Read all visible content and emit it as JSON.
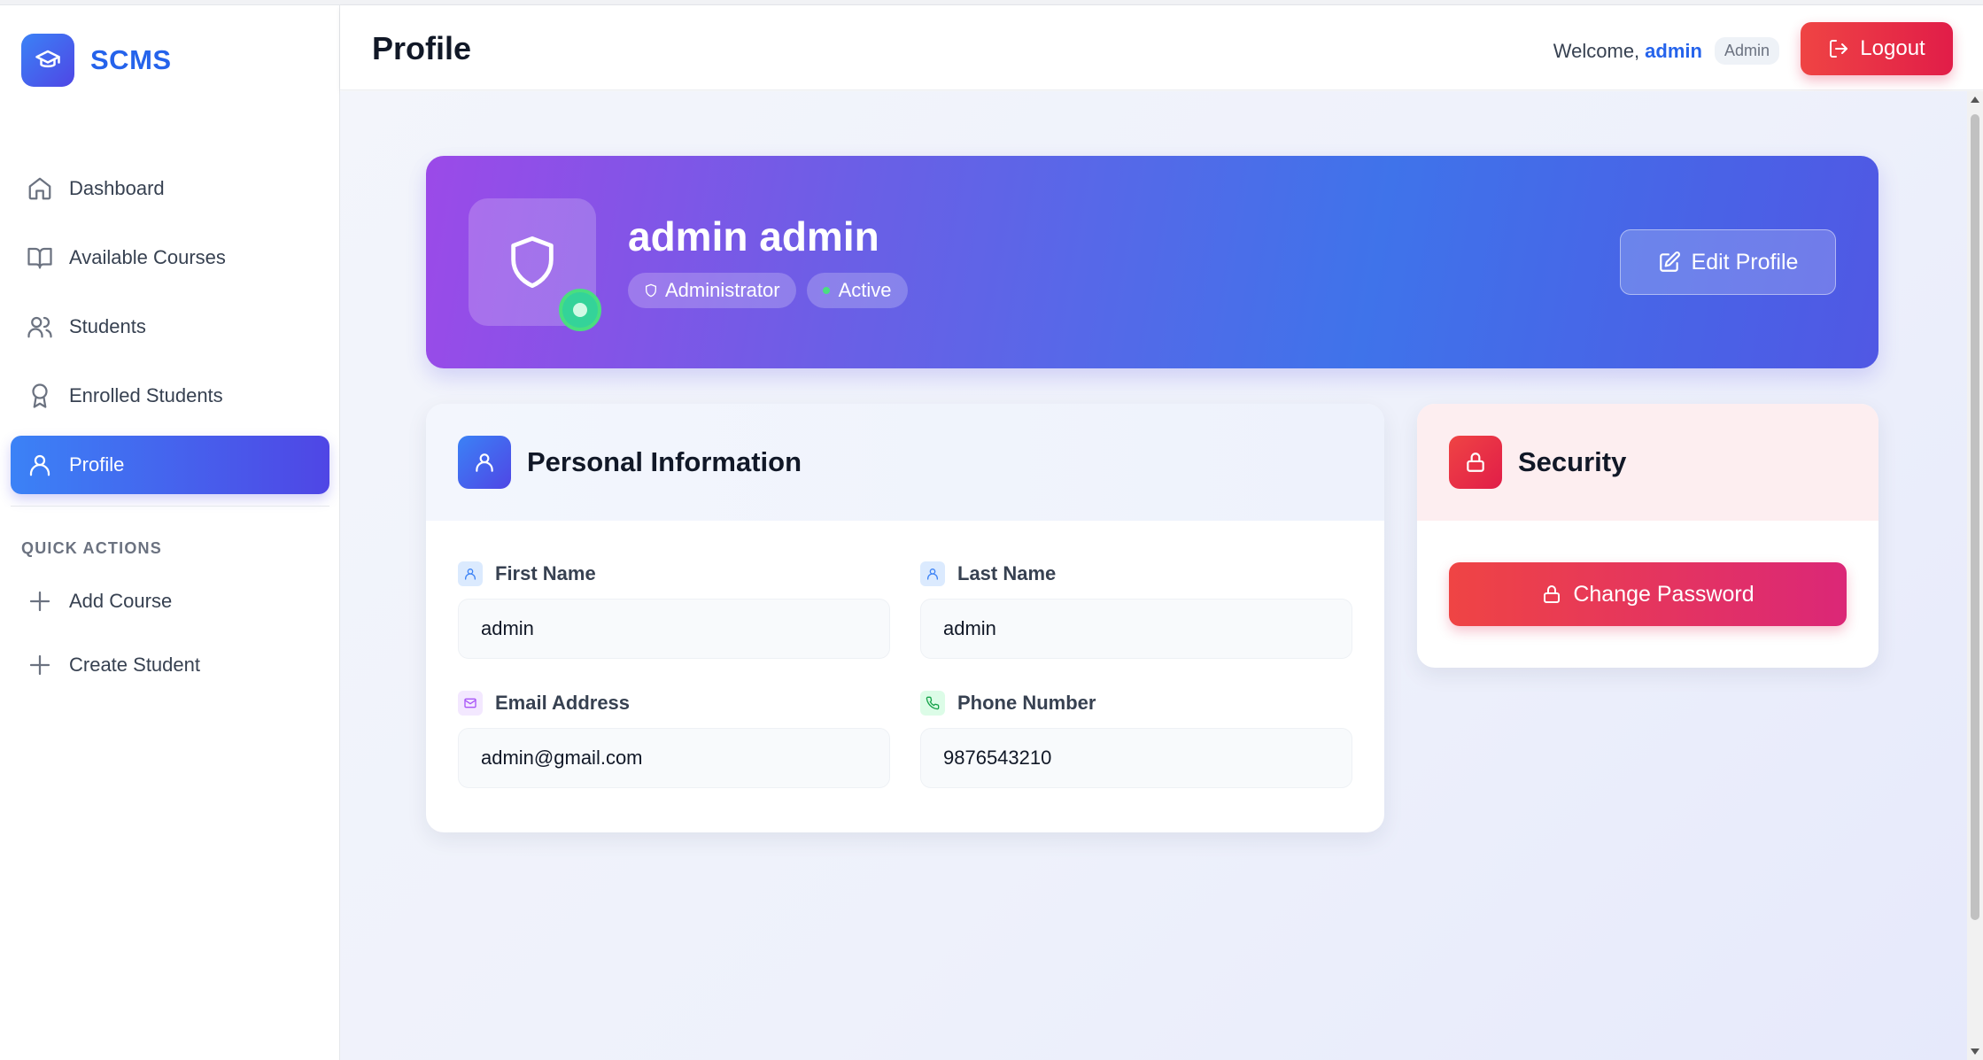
{
  "app": {
    "brand": "SCMS",
    "brand_icon": "graduation-cap-icon",
    "accent": "#2563eb"
  },
  "sidebar": {
    "items": [
      {
        "label": "Dashboard",
        "icon": "home-icon",
        "active": false
      },
      {
        "label": "Available Courses",
        "icon": "book-open-icon",
        "active": false
      },
      {
        "label": "Students",
        "icon": "users-icon",
        "active": false
      },
      {
        "label": "Enrolled Students",
        "icon": "award-icon",
        "active": false
      },
      {
        "label": "Profile",
        "icon": "user-icon",
        "active": true
      }
    ],
    "quick_actions_title": "QUICK ACTIONS",
    "quick_actions": [
      {
        "label": "Add Course",
        "icon": "plus-icon"
      },
      {
        "label": "Create Student",
        "icon": "plus-icon"
      }
    ]
  },
  "header": {
    "title": "Profile",
    "welcome_text": "Welcome,",
    "username": "admin",
    "role_badge": "Admin",
    "logout_label": "Logout"
  },
  "hero": {
    "name": "admin admin",
    "role": "Administrator",
    "status": "Active",
    "edit_label": "Edit Profile",
    "gradient": [
      "#9b4ae8",
      "#3f73ea",
      "#5058e4"
    ]
  },
  "personal": {
    "title": "Personal Information",
    "fields": [
      {
        "label": "First Name",
        "value": "admin",
        "icon": "user-icon"
      },
      {
        "label": "Last Name",
        "value": "admin",
        "icon": "user-icon"
      },
      {
        "label": "Email Address",
        "value": "admin@gmail.com",
        "icon": "mail-icon"
      },
      {
        "label": "Phone Number",
        "value": "9876543210",
        "icon": "phone-icon"
      }
    ]
  },
  "security": {
    "title": "Security",
    "change_password_label": "Change Password",
    "accent": "#ef4444"
  }
}
